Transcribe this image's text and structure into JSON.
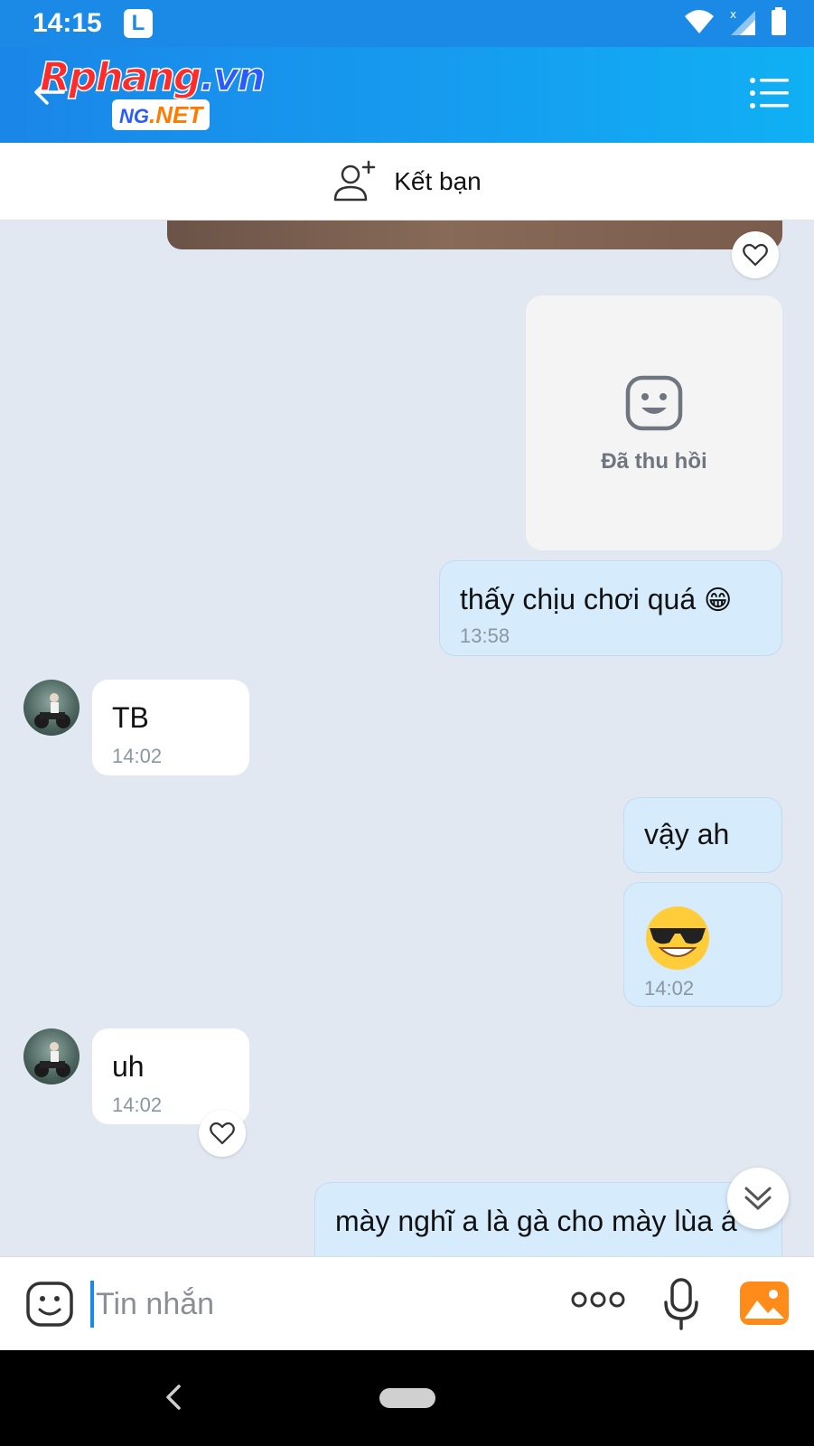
{
  "status_bar": {
    "time": "14:15",
    "app_badge": "L"
  },
  "header": {
    "logo_main_a": "Rphang",
    "logo_main_b": ".vn",
    "logo_sub_a": "NG",
    "logo_sub_b": ".NET"
  },
  "friend_bar": {
    "label": "Kết bạn",
    "icon": "add-friend-icon"
  },
  "messages": [
    {
      "id": "recalled",
      "side": "me",
      "text": "Đã thu hồi",
      "icon": "smile-icon"
    },
    {
      "id": "m1",
      "side": "me",
      "text": "thấy chịu chơi quá",
      "emoji": "😁",
      "time": "13:58"
    },
    {
      "id": "m2",
      "side": "them",
      "text": "TB",
      "time": "14:02"
    },
    {
      "id": "m3",
      "side": "me",
      "text": "vậy ah"
    },
    {
      "id": "m4",
      "side": "me",
      "emoji": "😎",
      "time": "14:02"
    },
    {
      "id": "m5",
      "side": "them",
      "text": "uh",
      "time": "14:02"
    },
    {
      "id": "m6",
      "side": "me",
      "text": "mày nghĩ a là gà cho mày lùa á"
    }
  ],
  "composer": {
    "placeholder": "Tin nhắn"
  },
  "colors": {
    "accent": "#1a8ae6",
    "my_bubble": "#d6ebfc",
    "their_bubble": "#ffffff",
    "chat_bg": "#e2e8f1"
  }
}
